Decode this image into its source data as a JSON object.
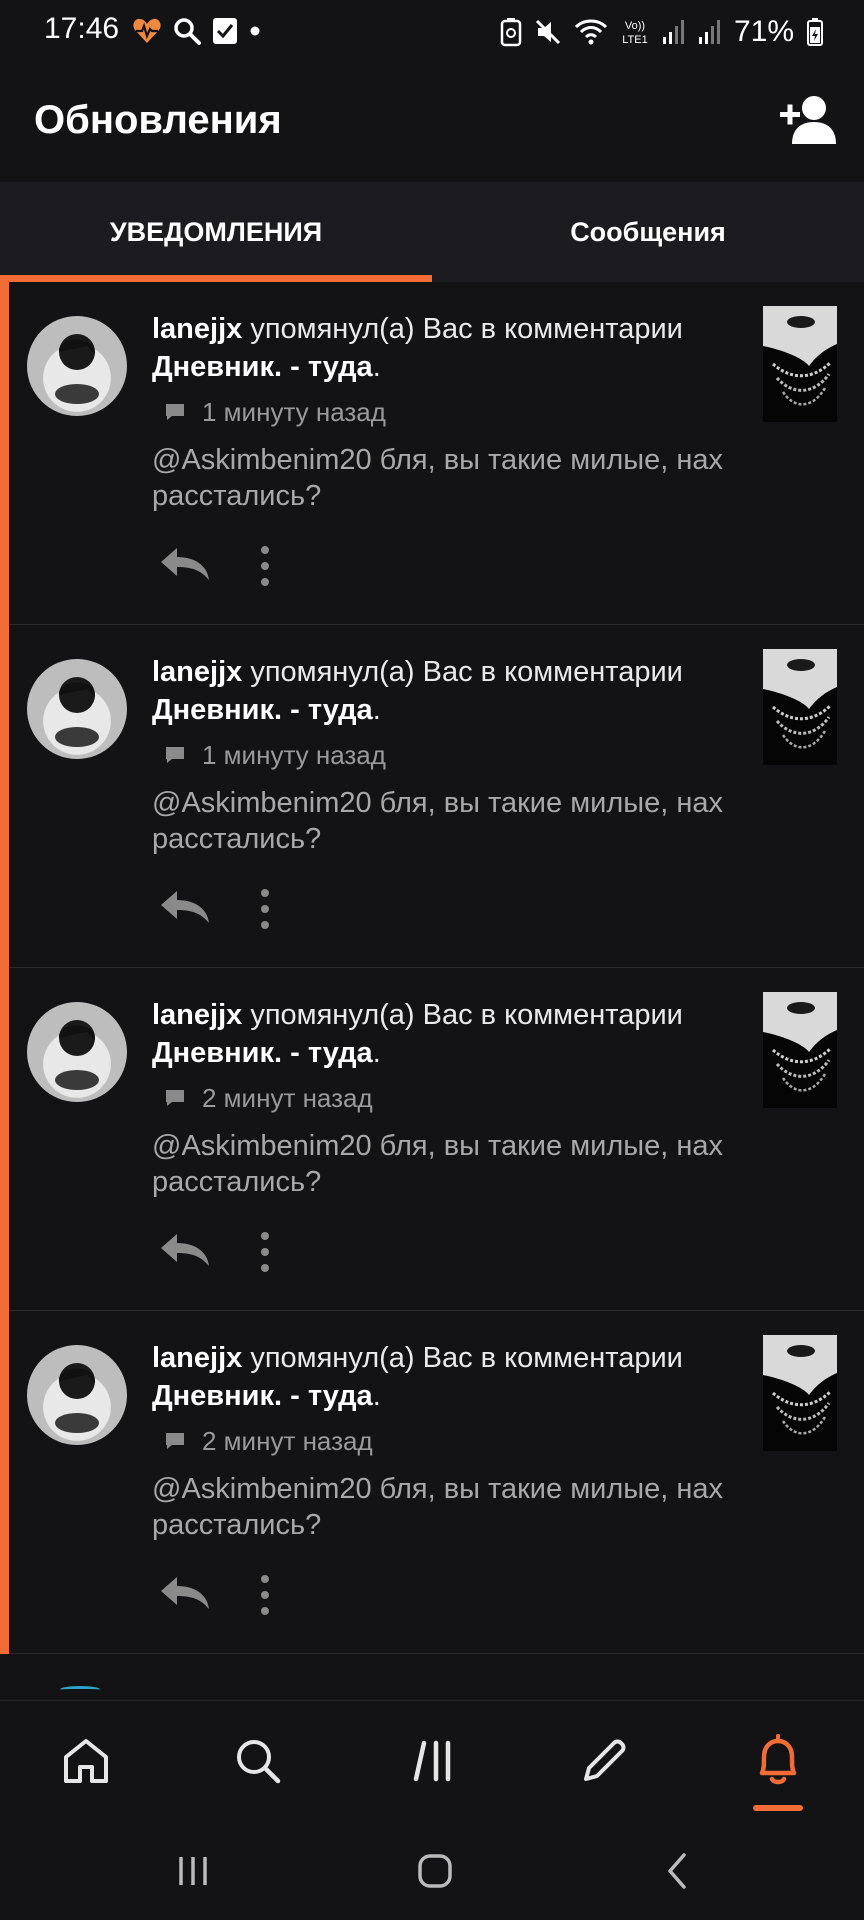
{
  "status_bar": {
    "time": "17:46",
    "battery_percent": "71%",
    "left_icons": [
      "heart-pulse-icon",
      "search-icon",
      "checkbox-icon",
      "dot-icon"
    ],
    "right_icons": [
      "battery-saver-icon",
      "mute-icon",
      "wifi-icon",
      "volte-lte-icon",
      "signal-icon",
      "signal-icon",
      "battery-icon"
    ],
    "volte_label": "Vo))\nLTE1"
  },
  "header": {
    "title": "Обновления",
    "add_user_icon": "add-user-icon"
  },
  "tabs": [
    {
      "label": "УВЕДОМЛЕНИЯ",
      "active": true
    },
    {
      "label": "Сообщения",
      "active": false
    }
  ],
  "colors": {
    "accent": "#f26d35",
    "background": "#131316",
    "tab_bar": "#1c1c20"
  },
  "notifications": [
    {
      "user": "lanejjx",
      "action": " упомянул(а) Вас в комментарии ",
      "post": "Дневник. - туда",
      "end": ".",
      "time": "1 минуту назад",
      "text": "@Askimbenim20 бля, вы такие милые, нах расстались?"
    },
    {
      "user": "lanejjx",
      "action": " упомянул(а) Вас в комментарии ",
      "post": "Дневник. - туда",
      "end": ".",
      "time": "1 минуту назад",
      "text": "@Askimbenim20 бля, вы такие милые, нах расстались?"
    },
    {
      "user": "lanejjx",
      "action": " упомянул(а) Вас в комментарии ",
      "post": "Дневник. - туда",
      "end": ".",
      "time": "2 минут назад",
      "text": "@Askimbenim20 бля, вы такие милые, нах расстались?"
    },
    {
      "user": "lanejjx",
      "action": " упомянул(а) Вас в комментарии ",
      "post": "Дневник. - туда",
      "end": ".",
      "time": "2 минут назад",
      "text": "@Askimbenim20 бля, вы такие милые, нах расстались?"
    }
  ],
  "bottom_nav": [
    {
      "icon": "home-icon",
      "active": false
    },
    {
      "icon": "search-icon",
      "active": false
    },
    {
      "icon": "feed-icon",
      "active": false
    },
    {
      "icon": "pencil-icon",
      "active": false
    },
    {
      "icon": "bell-icon",
      "active": true
    }
  ],
  "system_nav": [
    "recents-icon",
    "home-circle-icon",
    "back-icon"
  ]
}
